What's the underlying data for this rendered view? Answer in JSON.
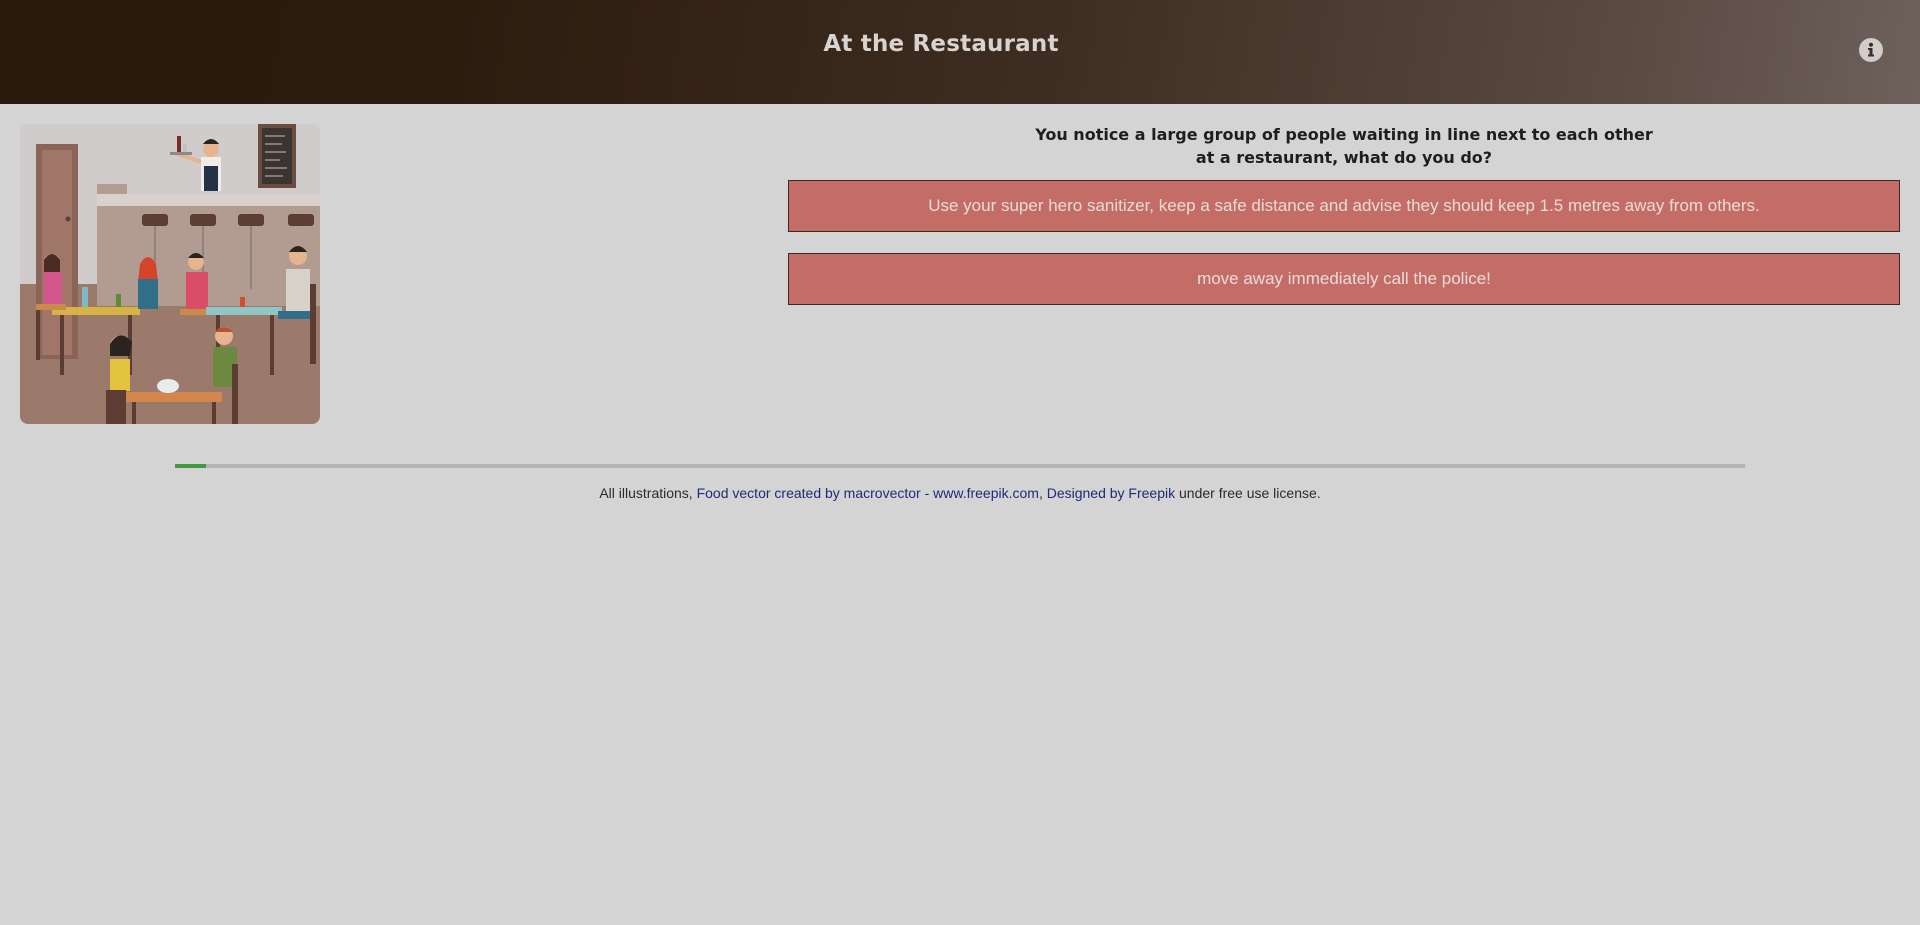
{
  "header": {
    "title": "At the Restaurant",
    "info_icon": "info-circle-icon"
  },
  "illustration": {
    "alt": "Restaurant scene illustration"
  },
  "question": {
    "line1": "You notice a large group of people waiting in line next to each other",
    "line2": "at a restaurant, what do you do?"
  },
  "answers": [
    {
      "label": "Use your super hero sanitizer, keep a safe distance and advise they should keep 1.5 metres away from others."
    },
    {
      "label": "move away immediately call the police!"
    }
  ],
  "progress": {
    "fraction": 0.02
  },
  "credits": {
    "prefix": "All illustrations, ",
    "link1": "Food vector created by macrovector - www.freepik.com",
    "separator": ", ",
    "link2": "Designed by Freepik",
    "suffix": " under free use license."
  },
  "colors": {
    "answer_bg": "#c46d66",
    "progress_fill": "#3f9a41",
    "page_bg": "#d4d4d4"
  }
}
